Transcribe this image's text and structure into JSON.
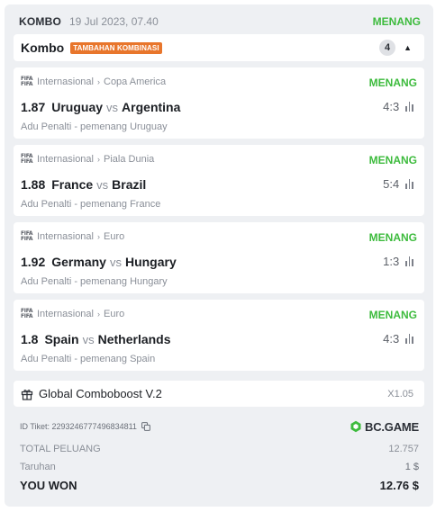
{
  "header": {
    "kombo": "KOMBO",
    "date": "19 Jul 2023, 07.40",
    "status": "MENANG"
  },
  "bar": {
    "title": "Kombo",
    "tag": "TAMBAHAN KOMBINASI",
    "count": "4"
  },
  "bets": [
    {
      "category": "Internasional",
      "league": "Copa America",
      "status": "MENANG",
      "odds": "1.87",
      "home": "Uruguay",
      "vs": "vs",
      "away": "Argentina",
      "score": "4:3",
      "pick": "Adu Penalti - pemenang Uruguay"
    },
    {
      "category": "Internasional",
      "league": "Piala Dunia",
      "status": "MENANG",
      "odds": "1.88",
      "home": "France",
      "vs": "vs",
      "away": "Brazil",
      "score": "5:4",
      "pick": "Adu Penalti - pemenang France"
    },
    {
      "category": "Internasional",
      "league": "Euro",
      "status": "MENANG",
      "odds": "1.92",
      "home": "Germany",
      "vs": "vs",
      "away": "Hungary",
      "score": "1:3",
      "pick": "Adu Penalti - pemenang Hungary"
    },
    {
      "category": "Internasional",
      "league": "Euro",
      "status": "MENANG",
      "odds": "1.8",
      "home": "Spain",
      "vs": "vs",
      "away": "Netherlands",
      "score": "4:3",
      "pick": "Adu Penalti - pemenang Spain"
    }
  ],
  "boost": {
    "name": "Global Comboboost V.2",
    "multiplier": "X1.05"
  },
  "ticket": {
    "id_label": "ID Tiket: 2293246777496834811",
    "brand": "BC.GAME"
  },
  "summary": {
    "total_label": "TOTAL PELUANG",
    "total_value": "12.757",
    "stake_label": "Taruhan",
    "stake_value": "1 $",
    "won_label": "YOU WON",
    "won_value": "12.76 $"
  },
  "colors": {
    "win": "#3dbb3d",
    "tag": "#e8762c",
    "brand_logo": "#3dbb3d"
  },
  "icons": {
    "league": "fifa-logo-icon",
    "stats": "stats-bars-icon",
    "gift": "gift-icon",
    "copy": "copy-icon",
    "collapse": "chevron-up-icon"
  }
}
